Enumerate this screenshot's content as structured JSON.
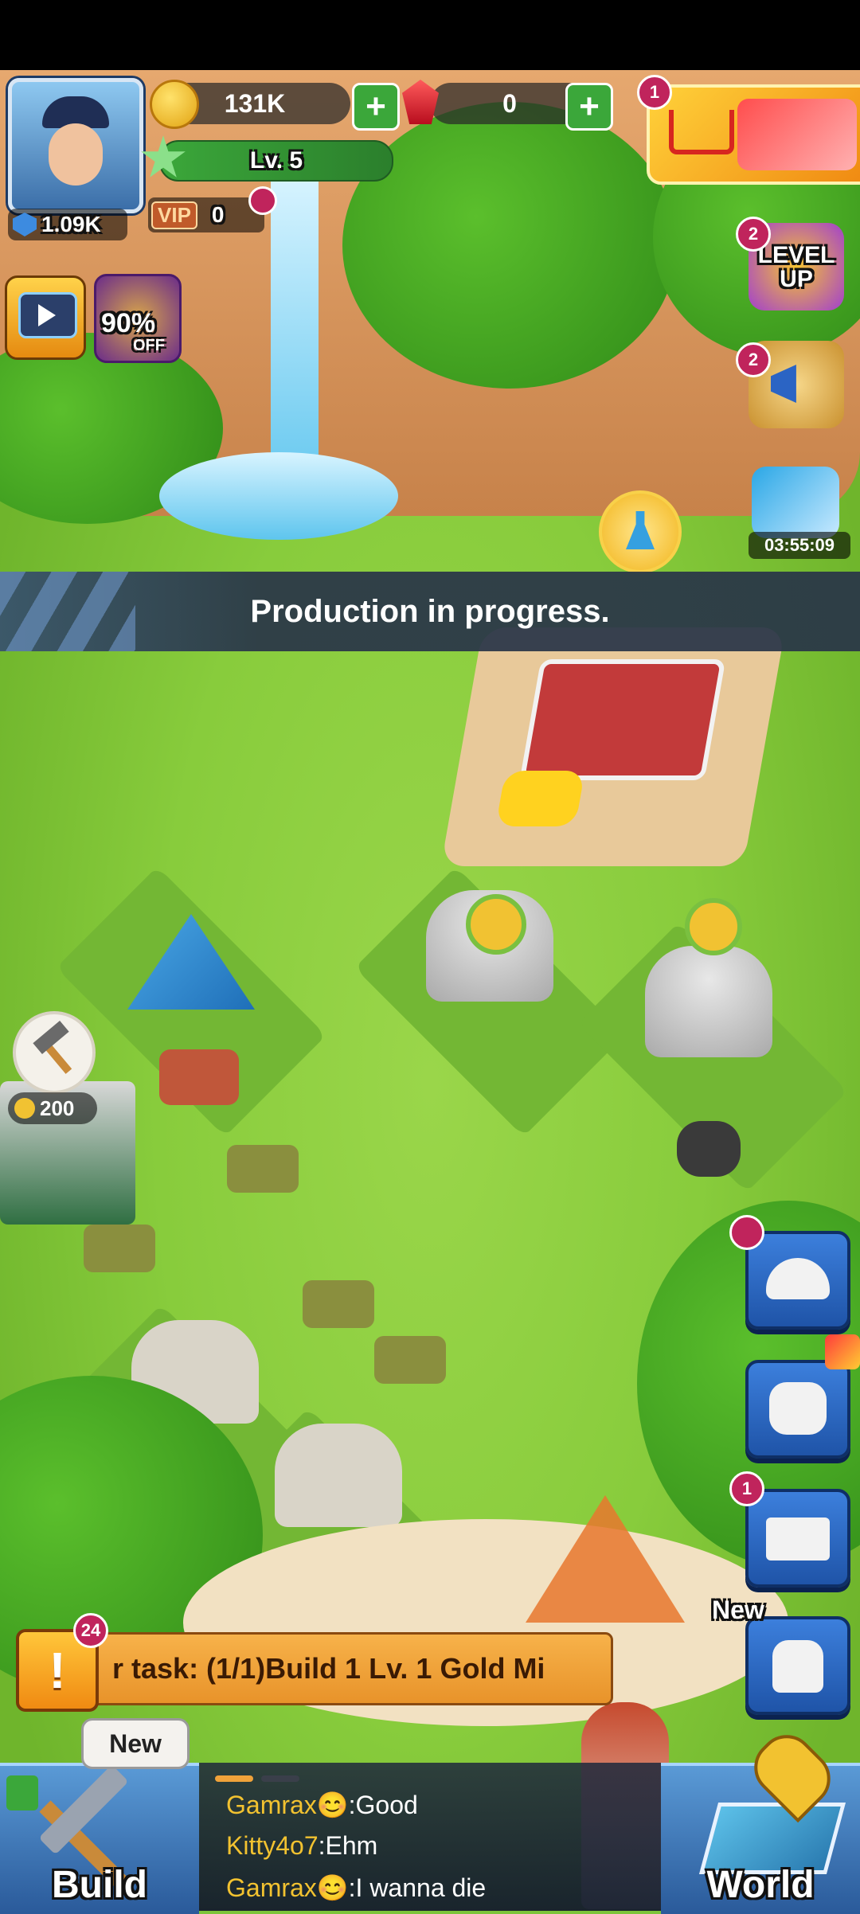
{
  "player": {
    "power": "1.09K",
    "level": "Lv. 5",
    "vip_label": "VIP",
    "vip_level": "0"
  },
  "resources": {
    "gold": "131K",
    "gems": "0"
  },
  "offers": {
    "discount_text": "90%",
    "discount_sub": "OFF",
    "shop_badge": "1",
    "level_up_text": "LEVEL UP",
    "level_up_badge": "2",
    "announce_badge": "2",
    "timer": "03:55:09"
  },
  "banner": {
    "message": "Production in progress."
  },
  "build_cost": "200",
  "side_menu": {
    "mail_badge": "1",
    "bag_new": "New"
  },
  "task": {
    "count": "24",
    "text": "r task: (1/1)Build 1 Lv. 1 Gold Mi"
  },
  "bottom": {
    "build_label": "Build",
    "build_new": "New",
    "world_label": "World"
  },
  "chat": [
    {
      "name": "Gamrax",
      "emoji": "😊",
      "sep": ":",
      "msg": "Good"
    },
    {
      "name": "Kitty4o7",
      "emoji": "",
      "sep": ":",
      "msg": "Ehm"
    },
    {
      "name": "Gamrax",
      "emoji": "😊",
      "sep": ":",
      "msg": "I wanna die"
    }
  ],
  "colors": {
    "grass": "#88cc3c",
    "accent_blue": "#2a64c0",
    "badge_pink": "#c0245c",
    "task_orange": "#f0a23a",
    "chat_name": "#f2c230"
  }
}
